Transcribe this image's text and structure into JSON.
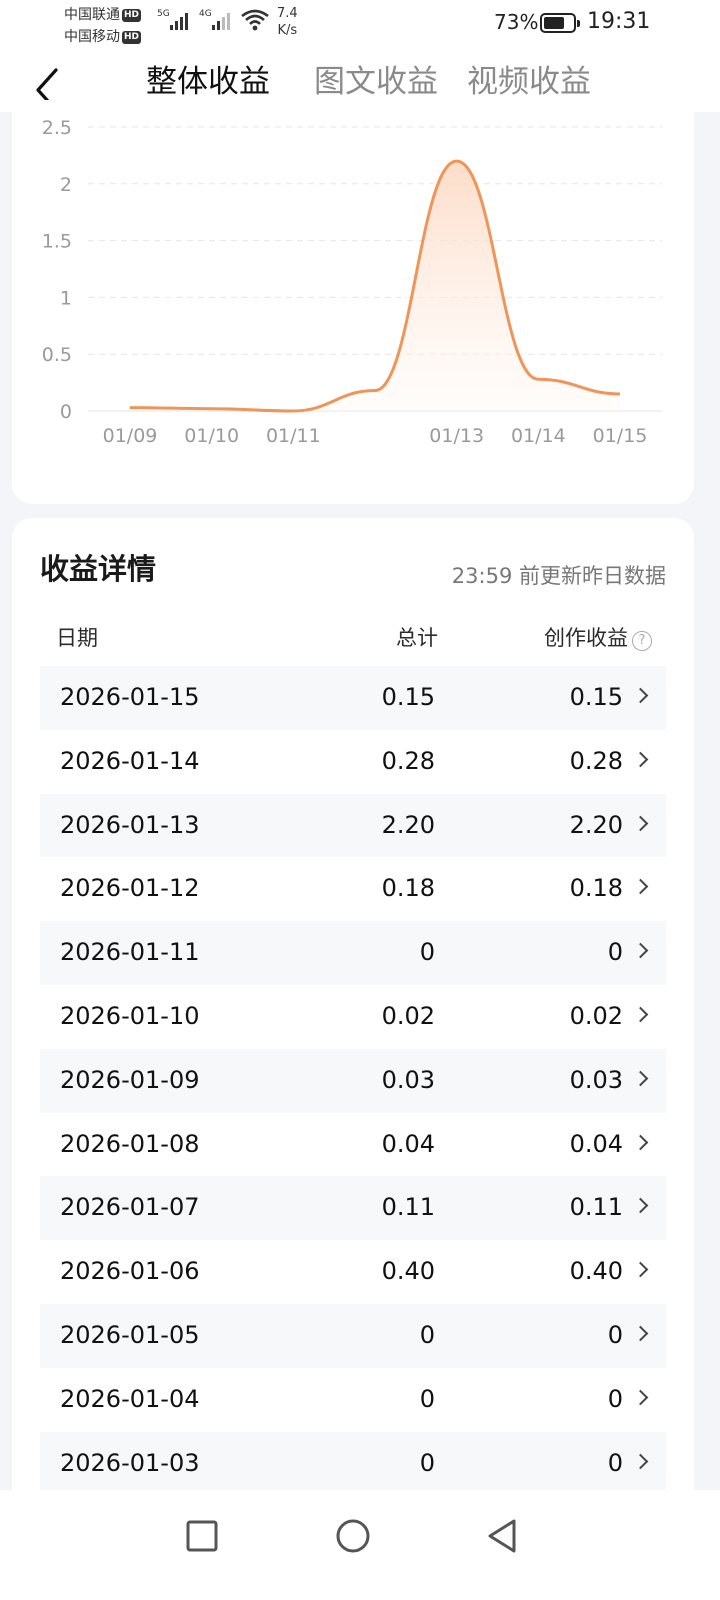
{
  "status_bar": {
    "carrier1": "中国联通",
    "carrier2": "中国移动",
    "hd": "HD",
    "sig1": "5G",
    "sig2": "4G",
    "net_speed_value": "7.4",
    "net_speed_unit": "K/s",
    "battery": "73%",
    "battery_level": 0.73,
    "time": "19:31"
  },
  "tabs": [
    {
      "label": "整体收益",
      "active": true
    },
    {
      "label": "图文收益",
      "active": false
    },
    {
      "label": "视频收益",
      "active": false
    }
  ],
  "chart_data": {
    "type": "area",
    "x": [
      "01/09",
      "01/10",
      "01/11",
      "01/12",
      "01/13",
      "01/14",
      "01/15"
    ],
    "xtick_labels": [
      "01/09",
      "01/10",
      "01/11",
      "",
      "01/13",
      "01/14",
      "01/15"
    ],
    "values": [
      0.03,
      0.02,
      0,
      0.18,
      2.2,
      0.28,
      0.15
    ],
    "yticks": [
      "0",
      "0.5",
      "1",
      "1.5",
      "2",
      "2.5"
    ],
    "ylim": [
      0,
      2.5
    ],
    "grid": true,
    "line_color": "#f0955a",
    "fill_color": "#fde2d0"
  },
  "details": {
    "title": "收益详情",
    "update_note": "23:59 前更新昨日数据",
    "col_date": "日期",
    "col_total": "总计",
    "col_income": "创作收益",
    "help": "?",
    "rows": [
      {
        "date": "2026-01-15",
        "total": "0.15",
        "income": "0.15"
      },
      {
        "date": "2026-01-14",
        "total": "0.28",
        "income": "0.28"
      },
      {
        "date": "2026-01-13",
        "total": "2.20",
        "income": "2.20"
      },
      {
        "date": "2026-01-12",
        "total": "0.18",
        "income": "0.18"
      },
      {
        "date": "2026-01-11",
        "total": "0",
        "income": "0"
      },
      {
        "date": "2026-01-10",
        "total": "0.02",
        "income": "0.02"
      },
      {
        "date": "2026-01-09",
        "total": "0.03",
        "income": "0.03"
      },
      {
        "date": "2026-01-08",
        "total": "0.04",
        "income": "0.04"
      },
      {
        "date": "2026-01-07",
        "total": "0.11",
        "income": "0.11"
      },
      {
        "date": "2026-01-06",
        "total": "0.40",
        "income": "0.40"
      },
      {
        "date": "2026-01-05",
        "total": "0",
        "income": "0"
      },
      {
        "date": "2026-01-04",
        "total": "0",
        "income": "0"
      },
      {
        "date": "2026-01-03",
        "total": "0",
        "income": "0"
      }
    ]
  },
  "nav": {
    "recent_icon": "square-icon",
    "home_icon": "circle-icon",
    "back_icon": "triangle-back-icon"
  }
}
